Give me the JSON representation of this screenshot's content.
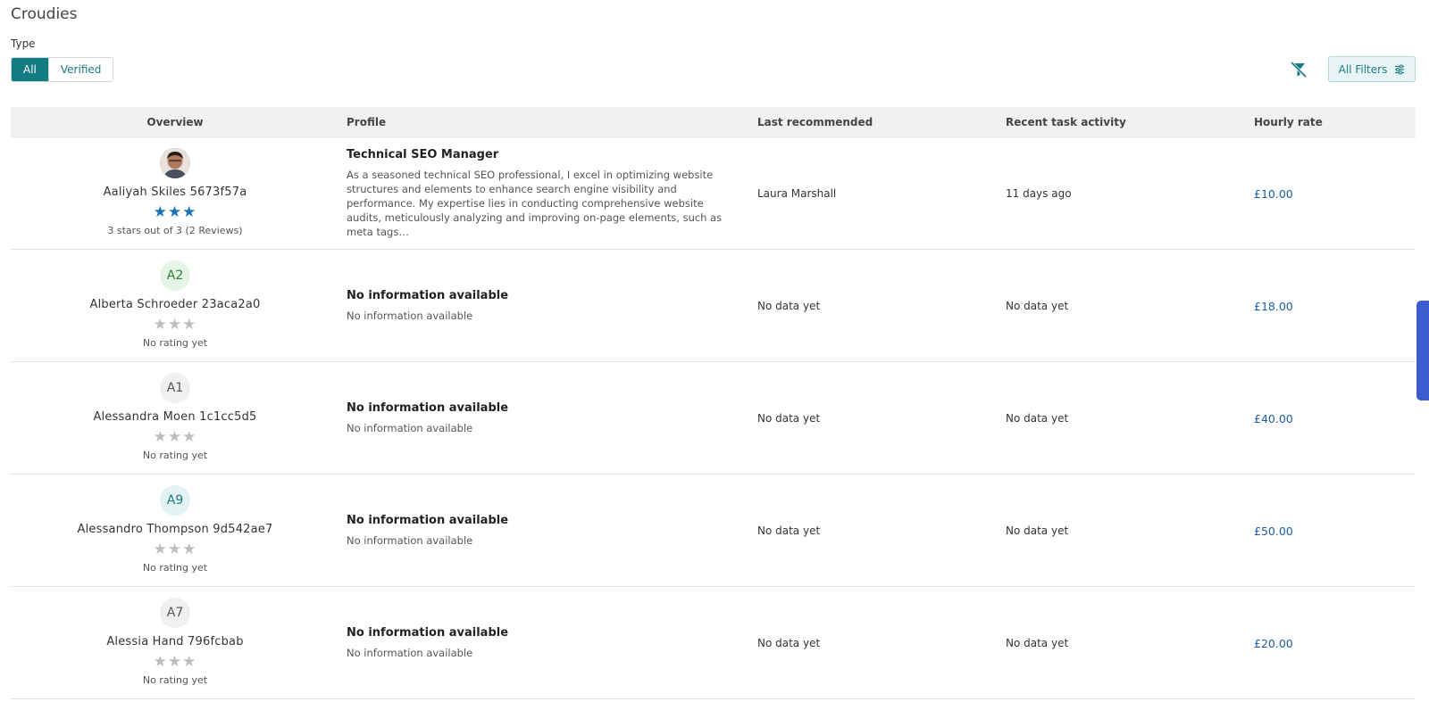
{
  "app": {
    "title": "Croudies"
  },
  "filters": {
    "type_label": "Type",
    "type_options": [
      "All",
      "Verified"
    ],
    "selected_type": "All",
    "all_filters_label": "All Filters"
  },
  "table": {
    "headers": {
      "overview": "Overview",
      "profile": "Profile",
      "last_recommended": "Last recommended",
      "recent_task_activity": "Recent task activity",
      "hourly_rate": "Hourly rate"
    },
    "rows": [
      {
        "avatar": "photo",
        "name": "Aaliyah Skiles 5673f57a",
        "stars_filled": 3,
        "stars_total": 3,
        "rating_text": "3 stars out of 3 (2 Reviews)",
        "profile_title": "Technical SEO Manager",
        "profile_desc": "As a seasoned technical SEO professional, I excel in optimizing website structures and elements to enhance search engine visibility and performance. My expertise lies in conducting comprehensive website audits, meticulously analyzing and improving on-page elements, such as meta tags…",
        "last_recommended": "Laura Marshall",
        "recent_task_activity": "11 days ago",
        "hourly_rate": "£10.00"
      },
      {
        "avatar": "A2",
        "avatar_bg": "#e6f4e6",
        "avatar_fg": "#2e7d32",
        "name": "Alberta Schroeder 23aca2a0",
        "stars_filled": 0,
        "stars_total": 3,
        "rating_text": "No rating yet",
        "profile_title": "No information available",
        "profile_desc": "No information available",
        "last_recommended": "No data yet",
        "recent_task_activity": "No data yet",
        "hourly_rate": "£18.00"
      },
      {
        "avatar": "A1",
        "avatar_bg": "#f0f0f0",
        "avatar_fg": "#555555",
        "name": "Alessandra Moen 1c1cc5d5",
        "stars_filled": 0,
        "stars_total": 3,
        "rating_text": "No rating yet",
        "profile_title": "No information available",
        "profile_desc": "No information available",
        "last_recommended": "No data yet",
        "recent_task_activity": "No data yet",
        "hourly_rate": "£40.00"
      },
      {
        "avatar": "A9",
        "avatar_bg": "#e3f2f3",
        "avatar_fg": "#1a7a80",
        "name": "Alessandro Thompson 9d542ae7",
        "stars_filled": 0,
        "stars_total": 3,
        "rating_text": "No rating yet",
        "profile_title": "No information available",
        "profile_desc": "No information available",
        "last_recommended": "No data yet",
        "recent_task_activity": "No data yet",
        "hourly_rate": "£50.00"
      },
      {
        "avatar": "A7",
        "avatar_bg": "#f0f0f0",
        "avatar_fg": "#555555",
        "name": "Alessia Hand 796fcbab",
        "stars_filled": 0,
        "stars_total": 3,
        "rating_text": "No rating yet",
        "profile_title": "No information available",
        "profile_desc": "No information available",
        "last_recommended": "No data yet",
        "recent_task_activity": "No data yet",
        "hourly_rate": "£20.00"
      }
    ]
  },
  "icons": {
    "clear_filter": "filter-off-icon",
    "all_filters": "sliders-icon",
    "star": "star-icon"
  },
  "colors": {
    "accent": "#127b83",
    "star_filled": "#1d6fb8",
    "star_empty": "#bdbdbd",
    "rate": "#1d5ea0",
    "side_tab": "#3d5bd1"
  }
}
